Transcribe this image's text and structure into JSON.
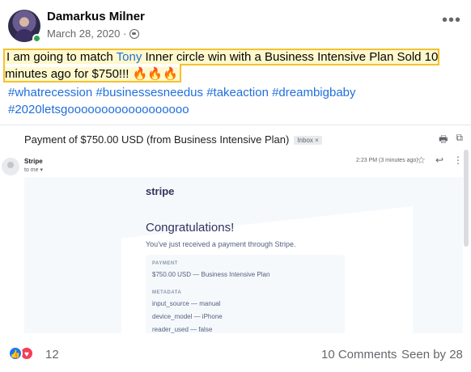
{
  "post": {
    "author": "Damarkus Milner",
    "date": "March 28, 2020 ·",
    "more_icon": "more-horizontal-icon",
    "audience_icon": "globe-icon",
    "text_before": "I am going to match ",
    "mention": "Tony",
    "text_after": " Inner circle win with a Business Intensive Plan Sold 10 minutes ago for $750!!! 🔥🔥🔥",
    "hashtags": [
      "#whatrecession",
      "#businessesneedus",
      "#takeaction",
      "#dreambigbaby",
      "#2020letsgoooooooooooooooooo"
    ],
    "highlight_color": "#f2c230",
    "link_color": "#216fdb"
  },
  "email": {
    "subject": "Payment of $750.00 USD (from Business Intensive Plan)",
    "inbox_label": "Inbox ×",
    "sender": "Stripe",
    "to": "to me ▾",
    "time": "2:23 PM (3 minutes ago)",
    "brand": "stripe",
    "heading": "Congratulations!",
    "subtext": "You've just received a payment through Stripe.",
    "payment_label": "PAYMENT",
    "payment_value": "$750.00 USD — Business Intensive Plan",
    "metadata_label": "METADATA",
    "metadata": [
      "input_source — manual",
      "device_model — iPhone",
      "reader_used — false"
    ]
  },
  "footer": {
    "reaction_count": "12",
    "comments": "10 Comments",
    "seen": "Seen by 28"
  }
}
